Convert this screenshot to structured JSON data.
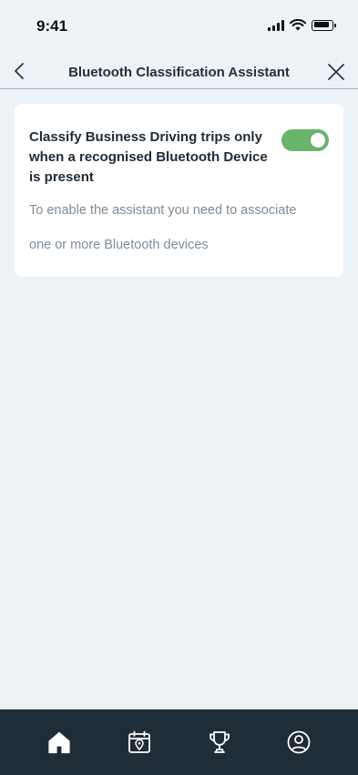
{
  "status_bar": {
    "time": "9:41"
  },
  "nav": {
    "title": "Bluetooth Classification Assistant"
  },
  "setting": {
    "heading": "Classify Business Driving trips only when a recognised Bluetooth Device is present",
    "enabled": true,
    "description": "To enable the assistant you need to associate one or more Bluetooth devices"
  },
  "tabs": [
    {
      "icon": "home-icon",
      "active": true
    },
    {
      "icon": "calendar-location-icon",
      "active": false
    },
    {
      "icon": "trophy-icon",
      "active": false
    },
    {
      "icon": "profile-icon",
      "active": false
    }
  ],
  "colors": {
    "background": "#edf2f6",
    "toggle_on": "#69b36a",
    "tab_bar": "#1f2d39"
  }
}
